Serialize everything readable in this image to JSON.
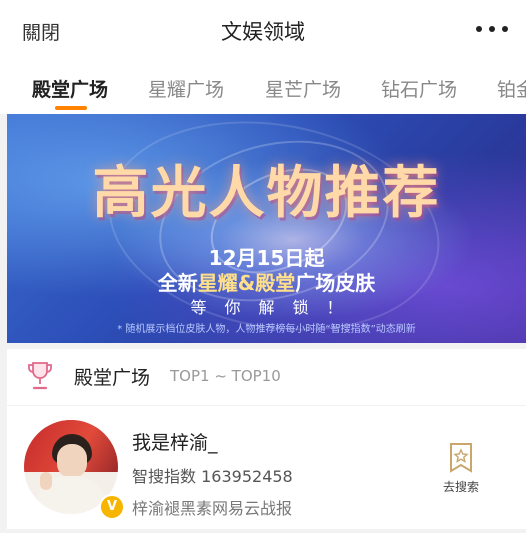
{
  "header": {
    "close_label": "關閉",
    "title": "文娱领域",
    "more_icon": "more-dots-icon"
  },
  "tabs": [
    {
      "label": "殿堂广场",
      "active": true
    },
    {
      "label": "星耀广场",
      "active": false
    },
    {
      "label": "星芒广场",
      "active": false
    },
    {
      "label": "钻石广场",
      "active": false
    },
    {
      "label": "铂金广场",
      "active": false
    }
  ],
  "banner": {
    "title": "高光人物推荐",
    "date": "12月15日起",
    "subtitle_prefix": "全新",
    "subtitle_highlight": "星耀&殿堂",
    "subtitle_suffix": "广场皮肤",
    "cta": "等你解锁！",
    "note": "* 随机展示档位皮肤人物，人物推荐榜每小时随“智搜指数”动态刷新"
  },
  "ranking": {
    "title": "殿堂广场",
    "range": "TOP1 ~ TOP10",
    "icon": "trophy-icon"
  },
  "user": {
    "name": "我是梓渝_",
    "index_label": "智搜指数",
    "index_value": "163952458",
    "description": "梓渝褪黑素网易云战报",
    "verified_icon": "verified-v-badge",
    "action_label": "去搜索",
    "action_icon": "bookmark-star-icon"
  },
  "colors": {
    "accent": "#ff8200",
    "badge": "#f7b500"
  }
}
